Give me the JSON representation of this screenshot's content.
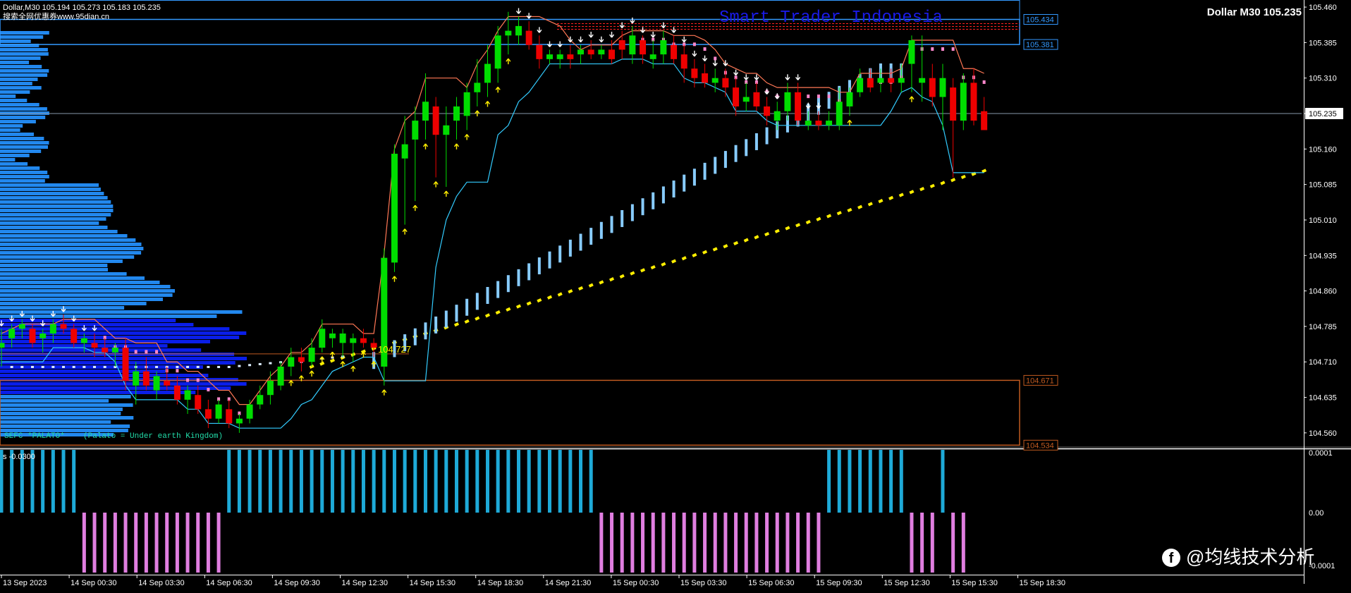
{
  "header": {
    "symbol_line": "Dollar,M30  105.194 105.273 105.183 105.235",
    "ad_line": "搜索全网优惠券www.95dian.cn",
    "title_right": "Dollar M30 105.235",
    "watermark": "Smart Trader Indonesia",
    "brand": "@均线技术分析",
    "brand_icon": "facebook-icon"
  },
  "annotations": {
    "poc_label": "104.727",
    "sefc_label": "SEFC *PALATO*",
    "sefc_caption": "(Palato = Under earth Kingdom)",
    "osc_label": "s -0.0300"
  },
  "colors": {
    "bull": "#00dd00",
    "bear": "#ee0000",
    "profile_light": "#2288ee",
    "profile_dark": "#0a1ee8",
    "cyan_line": "#33ccff",
    "salmon_line": "#ff7755",
    "light_blue_bars": "#88ccff",
    "yellow_dots": "#ffee00",
    "pink_dots": "#ff88cc",
    "osc_pos": "#1eaad8",
    "osc_neg": "#e07ee0",
    "box_blue": "#3399ff",
    "box_orange": "#c05a20",
    "red_zone": "#ff2222"
  },
  "chart_data": {
    "type": "candlestick",
    "symbol": "Dollar",
    "timeframe": "M30",
    "ohlc_current": {
      "open": 105.194,
      "high": 105.273,
      "low": 105.183,
      "close": 105.235
    },
    "y_ticks": [
      "105.460",
      "105.385",
      "105.310",
      "105.235",
      "105.160",
      "105.085",
      "105.010",
      "104.935",
      "104.860",
      "104.785",
      "104.710",
      "104.635",
      "104.560"
    ],
    "y_range": [
      104.53,
      105.475
    ],
    "price_boxes": [
      {
        "label": "105.434",
        "value": 105.434
      },
      {
        "label": "105.381",
        "value": 105.381
      },
      {
        "label": "104.671",
        "value": 104.671
      },
      {
        "label": "104.534",
        "value": 104.534
      }
    ],
    "current_price": {
      "label": "105.235",
      "value": 105.235
    },
    "x_labels": [
      "13 Sep 2023",
      "14 Sep 00:30",
      "14 Sep 03:30",
      "14 Sep 06:30",
      "14 Sep 09:30",
      "14 Sep 12:30",
      "14 Sep 15:30",
      "14 Sep 18:30",
      "14 Sep 21:30",
      "15 Sep 00:30",
      "15 Sep 03:30",
      "15 Sep 06:30",
      "15 Sep 09:30",
      "15 Sep 12:30",
      "15 Sep 15:30",
      "15 Sep 18:30"
    ],
    "candles": [
      [
        104.74,
        104.78,
        104.7,
        104.75
      ],
      [
        104.76,
        104.79,
        104.74,
        104.78
      ],
      [
        104.78,
        104.8,
        104.76,
        104.79
      ],
      [
        104.78,
        104.79,
        104.74,
        104.75
      ],
      [
        104.76,
        104.78,
        104.73,
        104.77
      ],
      [
        104.77,
        104.8,
        104.75,
        104.79
      ],
      [
        104.79,
        104.81,
        104.77,
        104.78
      ],
      [
        104.78,
        104.79,
        104.74,
        104.75
      ],
      [
        104.75,
        104.77,
        104.73,
        104.76
      ],
      [
        104.75,
        104.77,
        104.72,
        104.74
      ],
      [
        104.74,
        104.76,
        104.72,
        104.73
      ],
      [
        104.73,
        104.75,
        104.7,
        104.74
      ],
      [
        104.74,
        104.76,
        104.65,
        104.67
      ],
      [
        104.66,
        104.71,
        104.62,
        104.69
      ],
      [
        104.69,
        104.72,
        104.65,
        104.66
      ],
      [
        104.65,
        104.69,
        104.63,
        104.68
      ],
      [
        104.67,
        104.7,
        104.65,
        104.66
      ],
      [
        104.66,
        104.68,
        104.62,
        104.63
      ],
      [
        104.63,
        104.66,
        104.6,
        104.65
      ],
      [
        104.64,
        104.66,
        104.6,
        104.61
      ],
      [
        104.61,
        104.63,
        104.57,
        104.59
      ],
      [
        104.59,
        104.63,
        104.58,
        104.62
      ],
      [
        104.61,
        104.63,
        104.57,
        104.58
      ],
      [
        104.58,
        104.6,
        104.56,
        104.59
      ],
      [
        104.59,
        104.63,
        104.58,
        104.62
      ],
      [
        104.62,
        104.66,
        104.61,
        104.64
      ],
      [
        104.64,
        104.69,
        104.62,
        104.67
      ],
      [
        104.66,
        104.71,
        104.65,
        104.7
      ],
      [
        104.7,
        104.74,
        104.68,
        104.72
      ],
      [
        104.72,
        104.74,
        104.69,
        104.71
      ],
      [
        104.71,
        104.76,
        104.7,
        104.74
      ],
      [
        104.74,
        104.8,
        104.73,
        104.78
      ],
      [
        104.76,
        104.78,
        104.74,
        104.77
      ],
      [
        104.75,
        104.78,
        104.72,
        104.77
      ],
      [
        104.75,
        104.77,
        104.71,
        104.76
      ],
      [
        104.76,
        104.78,
        104.74,
        104.75
      ],
      [
        104.75,
        104.76,
        104.72,
        104.74
      ],
      [
        104.7,
        104.95,
        104.66,
        104.93
      ],
      [
        104.92,
        105.17,
        104.9,
        105.15
      ],
      [
        105.14,
        105.23,
        105.0,
        105.17
      ],
      [
        105.18,
        105.25,
        105.05,
        105.22
      ],
      [
        105.22,
        105.32,
        105.18,
        105.26
      ],
      [
        105.25,
        105.27,
        105.1,
        105.19
      ],
      [
        105.19,
        105.25,
        105.08,
        105.21
      ],
      [
        105.22,
        105.27,
        105.18,
        105.25
      ],
      [
        105.23,
        105.3,
        105.2,
        105.28
      ],
      [
        105.28,
        105.35,
        105.25,
        105.3
      ],
      [
        105.3,
        105.38,
        105.27,
        105.34
      ],
      [
        105.33,
        105.42,
        105.3,
        105.4
      ],
      [
        105.4,
        105.45,
        105.36,
        105.41
      ],
      [
        105.4,
        105.44,
        105.38,
        105.42
      ],
      [
        105.41,
        105.43,
        105.37,
        105.38
      ],
      [
        105.38,
        105.4,
        105.33,
        105.35
      ],
      [
        105.35,
        105.37,
        105.34,
        105.36
      ],
      [
        105.35,
        105.37,
        105.33,
        105.36
      ],
      [
        105.36,
        105.38,
        105.33,
        105.35
      ],
      [
        105.36,
        105.38,
        105.34,
        105.37
      ],
      [
        105.37,
        105.39,
        105.35,
        105.36
      ],
      [
        105.36,
        105.38,
        105.35,
        105.37
      ],
      [
        105.37,
        105.39,
        105.34,
        105.35
      ],
      [
        105.39,
        105.41,
        105.35,
        105.37
      ],
      [
        105.36,
        105.42,
        105.34,
        105.4
      ],
      [
        105.39,
        105.4,
        105.34,
        105.36
      ],
      [
        105.35,
        105.39,
        105.33,
        105.36
      ],
      [
        105.36,
        105.41,
        105.34,
        105.39
      ],
      [
        105.38,
        105.4,
        105.34,
        105.35
      ],
      [
        105.36,
        105.38,
        105.3,
        105.33
      ],
      [
        105.33,
        105.35,
        105.29,
        105.31
      ],
      [
        105.32,
        105.34,
        105.29,
        105.3
      ],
      [
        105.3,
        105.33,
        105.28,
        105.31
      ],
      [
        105.31,
        105.33,
        105.27,
        105.29
      ],
      [
        105.29,
        105.31,
        105.23,
        105.25
      ],
      [
        105.26,
        105.3,
        105.24,
        105.27
      ],
      [
        105.28,
        105.3,
        105.24,
        105.25
      ],
      [
        105.25,
        105.27,
        105.21,
        105.23
      ],
      [
        105.22,
        105.26,
        105.2,
        105.24
      ],
      [
        105.24,
        105.3,
        105.22,
        105.28
      ],
      [
        105.28,
        105.3,
        105.21,
        105.22
      ],
      [
        105.21,
        105.24,
        105.2,
        105.22
      ],
      [
        105.22,
        105.24,
        105.2,
        105.21
      ],
      [
        105.21,
        105.24,
        105.2,
        105.22
      ],
      [
        105.21,
        105.29,
        105.2,
        105.26
      ],
      [
        105.25,
        105.29,
        105.23,
        105.28
      ],
      [
        105.28,
        105.33,
        105.27,
        105.31
      ],
      [
        105.31,
        105.33,
        105.28,
        105.29
      ],
      [
        105.3,
        105.33,
        105.28,
        105.31
      ],
      [
        105.31,
        105.33,
        105.28,
        105.3
      ],
      [
        105.3,
        105.34,
        105.28,
        105.31
      ],
      [
        105.34,
        105.4,
        105.28,
        105.39
      ],
      [
        105.3,
        105.4,
        105.26,
        105.31
      ],
      [
        105.31,
        105.34,
        105.25,
        105.27
      ],
      [
        105.27,
        105.34,
        105.2,
        105.31
      ],
      [
        105.29,
        105.31,
        105.1,
        105.22
      ],
      [
        105.22,
        105.32,
        105.2,
        105.3
      ],
      [
        105.3,
        105.33,
        105.21,
        105.22
      ],
      [
        105.24,
        105.27,
        105.22,
        105.2
      ]
    ],
    "oscillator": {
      "label": "s -0.0300",
      "y_ticks": [
        "0.0001",
        "0.00",
        "-0.0001"
      ],
      "values": [
        1,
        1,
        1,
        1,
        1,
        1,
        1,
        1,
        -1,
        -1,
        -1,
        -1,
        -1,
        -1,
        -1,
        -1,
        -1,
        -1,
        -1,
        -1,
        -1,
        -1,
        1,
        1,
        1,
        1,
        1,
        1,
        1,
        1,
        1,
        1,
        1,
        1,
        1,
        1,
        1,
        1,
        1,
        1,
        1,
        1,
        1,
        1,
        1,
        1,
        1,
        1,
        1,
        1,
        1,
        1,
        1,
        1,
        1,
        1,
        1,
        1,
        -1,
        -1,
        -1,
        -1,
        -1,
        -1,
        -1,
        -1,
        -1,
        -1,
        -1,
        -1,
        -1,
        -1,
        -1,
        -1,
        -1,
        -1,
        -1,
        -1,
        -1,
        -1,
        1,
        1,
        1,
        1,
        1,
        1,
        1,
        1,
        -1,
        -1,
        -1,
        1,
        -1,
        -1
      ]
    }
  }
}
